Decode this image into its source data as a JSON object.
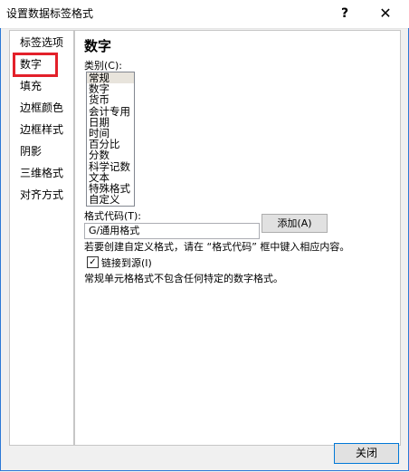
{
  "window": {
    "title": "设置数据标签格式",
    "help_label": "?",
    "close_label": "✕"
  },
  "sidebar": {
    "items": [
      {
        "label": "标签选项"
      },
      {
        "label": "数字"
      },
      {
        "label": "填充"
      },
      {
        "label": "边框颜色"
      },
      {
        "label": "边框样式"
      },
      {
        "label": "阴影"
      },
      {
        "label": "三维格式"
      },
      {
        "label": "对齐方式"
      }
    ],
    "highlight_color": "#e3202a"
  },
  "main": {
    "heading": "数字",
    "category_label": "类别(C):",
    "categories": [
      "常规",
      "数字",
      "货币",
      "会计专用",
      "日期",
      "时间",
      "百分比",
      "分数",
      "科学记数",
      "文本",
      "特殊格式",
      "自定义"
    ],
    "selected_category": "常规",
    "format_code_label": "格式代码(T):",
    "format_code_value": "G/通用格式",
    "add_button": "添加(A)",
    "hint": "若要创建自定义格式，请在 “格式代码” 框中键入相应内容。",
    "link_checkbox_label": "链接到源(I)",
    "link_checked": true,
    "description": "常规单元格格式不包含任何特定的数字格式。"
  },
  "footer": {
    "close_button": "关闭"
  }
}
